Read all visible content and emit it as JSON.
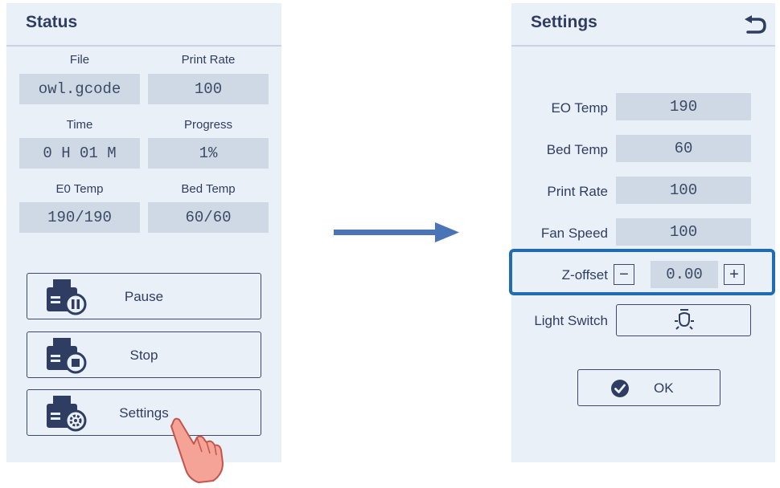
{
  "status": {
    "title": "Status",
    "fields": [
      {
        "label": "File",
        "value": "owl.gcode"
      },
      {
        "label": "Print Rate",
        "value": "100"
      },
      {
        "label": "Time",
        "value": "0 H 01 M"
      },
      {
        "label": "Progress",
        "value": "1%"
      },
      {
        "label": "E0 Temp",
        "value": "190/190"
      },
      {
        "label": "Bed Temp",
        "value": "60/60"
      }
    ],
    "buttons": {
      "pause": "Pause",
      "stop": "Stop",
      "settings": "Settings"
    }
  },
  "settings": {
    "title": "Settings",
    "rows": [
      {
        "label": "EO Temp",
        "value": "190"
      },
      {
        "label": "Bed Temp",
        "value": "60"
      },
      {
        "label": "Print Rate",
        "value": "100"
      },
      {
        "label": "Fan Speed",
        "value": "100"
      }
    ],
    "zoffset": {
      "label": "Z-offset",
      "value": "0.00",
      "minus": "−",
      "plus": "+"
    },
    "light_switch": {
      "label": "Light Switch"
    },
    "ok_label": "OK"
  },
  "icons": {
    "back": "back-arrow-icon",
    "printer_pause": "printer-pause-icon",
    "printer_stop": "printer-stop-icon",
    "printer_settings": "printer-settings-icon",
    "light": "light-bulb-icon",
    "check": "check-circle-icon",
    "hand": "pointing-hand-icon",
    "flow_arrow": "flow-arrow-icon"
  },
  "colors": {
    "panel_bg": "#eaf0f7",
    "value_bg": "#cfd9e6",
    "text": "#2f3d63",
    "highlight": "#1f6cb3",
    "arrow": "#4a74b5",
    "hand": "#f4a396"
  }
}
